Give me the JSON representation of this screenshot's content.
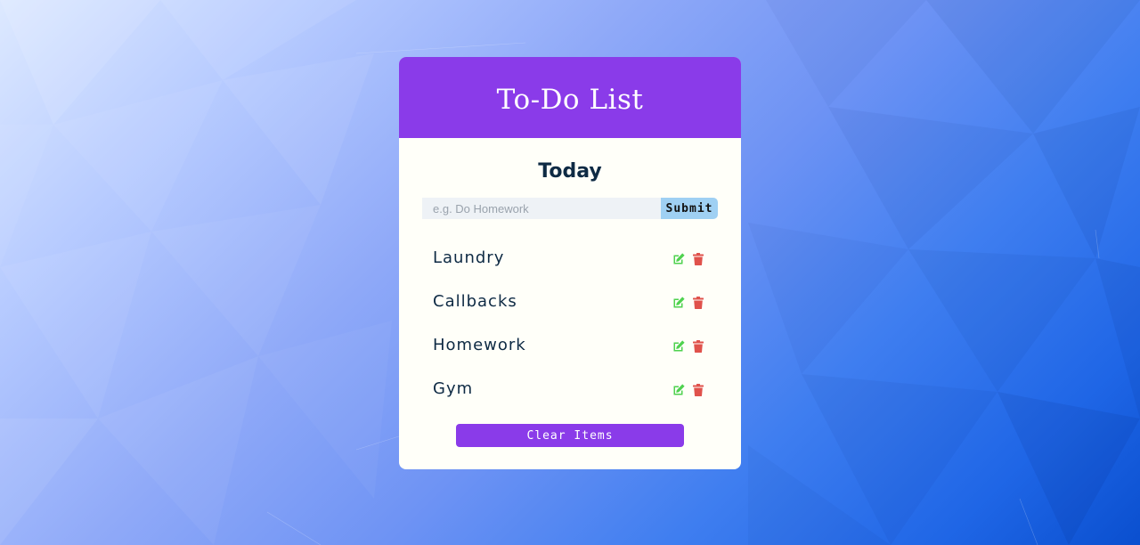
{
  "app": {
    "title": "To-Do List"
  },
  "list": {
    "heading": "Today"
  },
  "entry": {
    "placeholder": "e.g. Do Homework",
    "value": "",
    "submit_label": "Submit"
  },
  "tasks": [
    {
      "label": "Laundry",
      "edit_icon": "edit-icon",
      "delete_icon": "trash-icon"
    },
    {
      "label": "Callbacks",
      "edit_icon": "edit-icon",
      "delete_icon": "trash-icon"
    },
    {
      "label": "Homework",
      "edit_icon": "edit-icon",
      "delete_icon": "trash-icon"
    },
    {
      "label": "Gym",
      "edit_icon": "edit-icon",
      "delete_icon": "trash-icon"
    }
  ],
  "footer": {
    "clear_label": "Clear Items"
  },
  "colors": {
    "header": "#8a3be9",
    "card": "#fffff9",
    "submit": "#9fd0f3",
    "edit_icon": "#4fd24f",
    "delete_icon": "#e0524c",
    "text": "#0e2a44"
  }
}
